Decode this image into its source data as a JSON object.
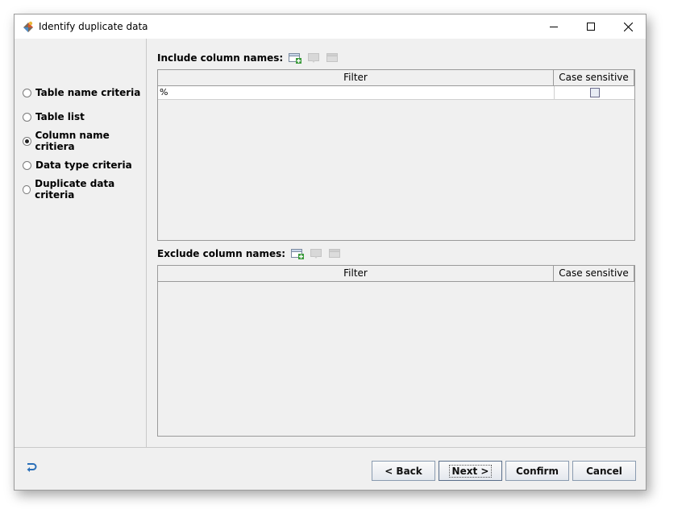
{
  "window": {
    "title": "Identify duplicate data"
  },
  "sidebar": {
    "items": [
      {
        "label": "Table name criteria",
        "checked": false
      },
      {
        "label": "Table list",
        "checked": false
      },
      {
        "label": "Column name critiera",
        "checked": true
      },
      {
        "label": "Data type criteria",
        "checked": false
      },
      {
        "label": "Duplicate data criteria",
        "checked": false
      }
    ]
  },
  "include": {
    "label": "Include column names:",
    "columns": {
      "filter": "Filter",
      "case": "Case sensitive"
    },
    "rows": [
      {
        "filter": "%",
        "case_sensitive": false
      }
    ]
  },
  "exclude": {
    "label": "Exclude column names:",
    "columns": {
      "filter": "Filter",
      "case": "Case sensitive"
    }
  },
  "buttons": {
    "back": "< Back",
    "next": "Next >",
    "confirm": "Confirm",
    "cancel": "Cancel"
  },
  "colors": {
    "add_icon_green": "#3a9a3a",
    "back_icon_blue": "#2a6fb8"
  }
}
